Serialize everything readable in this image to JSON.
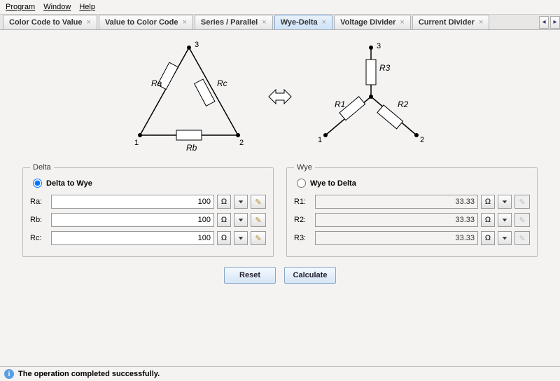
{
  "menu": {
    "program": "Program",
    "window": "Window",
    "help": "Help"
  },
  "tabs": [
    {
      "label": "Color Code to Value"
    },
    {
      "label": "Value to Color Code"
    },
    {
      "label": "Series / Parallel"
    },
    {
      "label": "Wye-Delta"
    },
    {
      "label": "Voltage Divider"
    },
    {
      "label": "Current Divider"
    }
  ],
  "active_tab_index": 3,
  "diagram": {
    "delta": {
      "Ra": "Ra",
      "Rb": "Rb",
      "Rc": "Rc",
      "n1": "1",
      "n2": "2",
      "n3": "3"
    },
    "wye": {
      "R1": "R1",
      "R2": "R2",
      "R3": "R3",
      "n1": "1",
      "n2": "2",
      "n3": "3"
    }
  },
  "delta_panel": {
    "legend": "Delta",
    "radio": "Delta to Wye",
    "rows": [
      {
        "label": "Ra:",
        "value": "100",
        "unit": "Ω"
      },
      {
        "label": "Rb:",
        "value": "100",
        "unit": "Ω"
      },
      {
        "label": "Rc:",
        "value": "100",
        "unit": "Ω"
      }
    ]
  },
  "wye_panel": {
    "legend": "Wye",
    "radio": "Wye to Delta",
    "rows": [
      {
        "label": "R1:",
        "value": "33.33",
        "unit": "Ω"
      },
      {
        "label": "R2:",
        "value": "33.33",
        "unit": "Ω"
      },
      {
        "label": "R3:",
        "value": "33.33",
        "unit": "Ω"
      }
    ]
  },
  "buttons": {
    "reset": "Reset",
    "calculate": "Calculate"
  },
  "status": "The operation completed successfully."
}
